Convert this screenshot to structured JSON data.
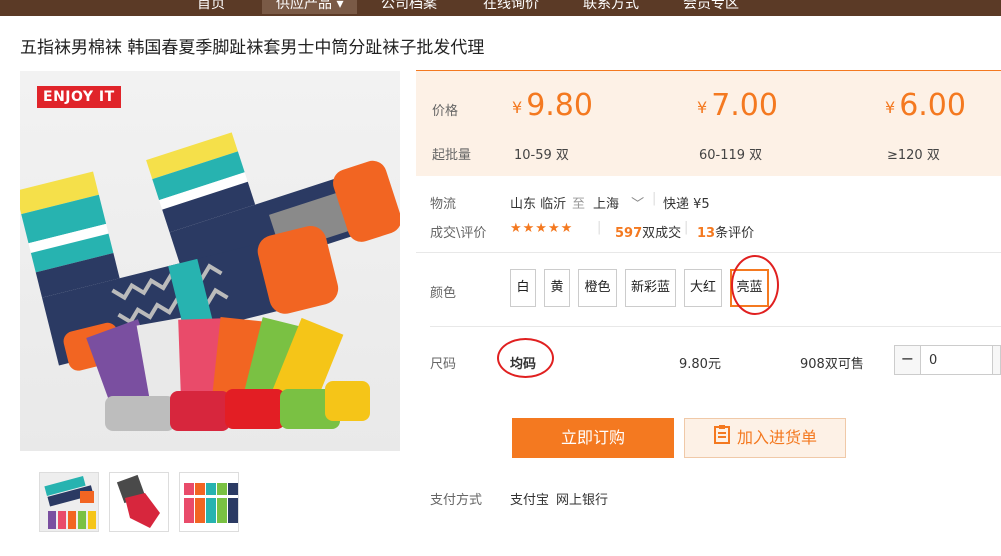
{
  "nav": {
    "items": [
      "首页",
      "供应产品 ▾",
      "公司档案",
      "在线询价",
      "联系方式",
      "会员专区"
    ]
  },
  "product": {
    "title": "五指袜男棉袜 韩国春夏季脚趾袜套男士中筒分趾袜子批发代理",
    "brand_badge": "ENJOY IT"
  },
  "price_box": {
    "price_label": "价格",
    "moq_label": "起批量",
    "currency": "¥",
    "tiers": [
      {
        "price": "9.80",
        "range": "10-59 双"
      },
      {
        "price": "7.00",
        "range": "60-119 双"
      },
      {
        "price": "6.00",
        "range": "≥120 双"
      }
    ]
  },
  "logistics": {
    "label": "物流",
    "origin": "山东 临沂",
    "to": "至",
    "destination": "上海",
    "express": "快递",
    "fee": "¥5"
  },
  "deals": {
    "label": "成交\\评价",
    "stars": "★★★★★",
    "deal_count": "597",
    "deal_unit": "双成交",
    "review_count": "13",
    "review_unit": "条评价"
  },
  "colors": {
    "label": "颜色",
    "options": [
      "白",
      "黄",
      "橙色",
      "新彩蓝",
      "大红",
      "亮蓝"
    ],
    "selected_index": 5
  },
  "size": {
    "label": "尺码",
    "value": "均码",
    "price": "9.80元",
    "stock": "908双可售",
    "quantity": "0",
    "minus": "−"
  },
  "actions": {
    "buy_now": "立即订购",
    "add_to_cart": "加入进货单"
  },
  "payment": {
    "label": "支付方式",
    "methods": [
      "支付宝",
      "网上银行"
    ]
  },
  "colors_theme": {
    "accent": "#f47920",
    "nav_bg": "#5b3a26",
    "price_bg": "#fdf1e6",
    "annotation": "#e02020"
  }
}
